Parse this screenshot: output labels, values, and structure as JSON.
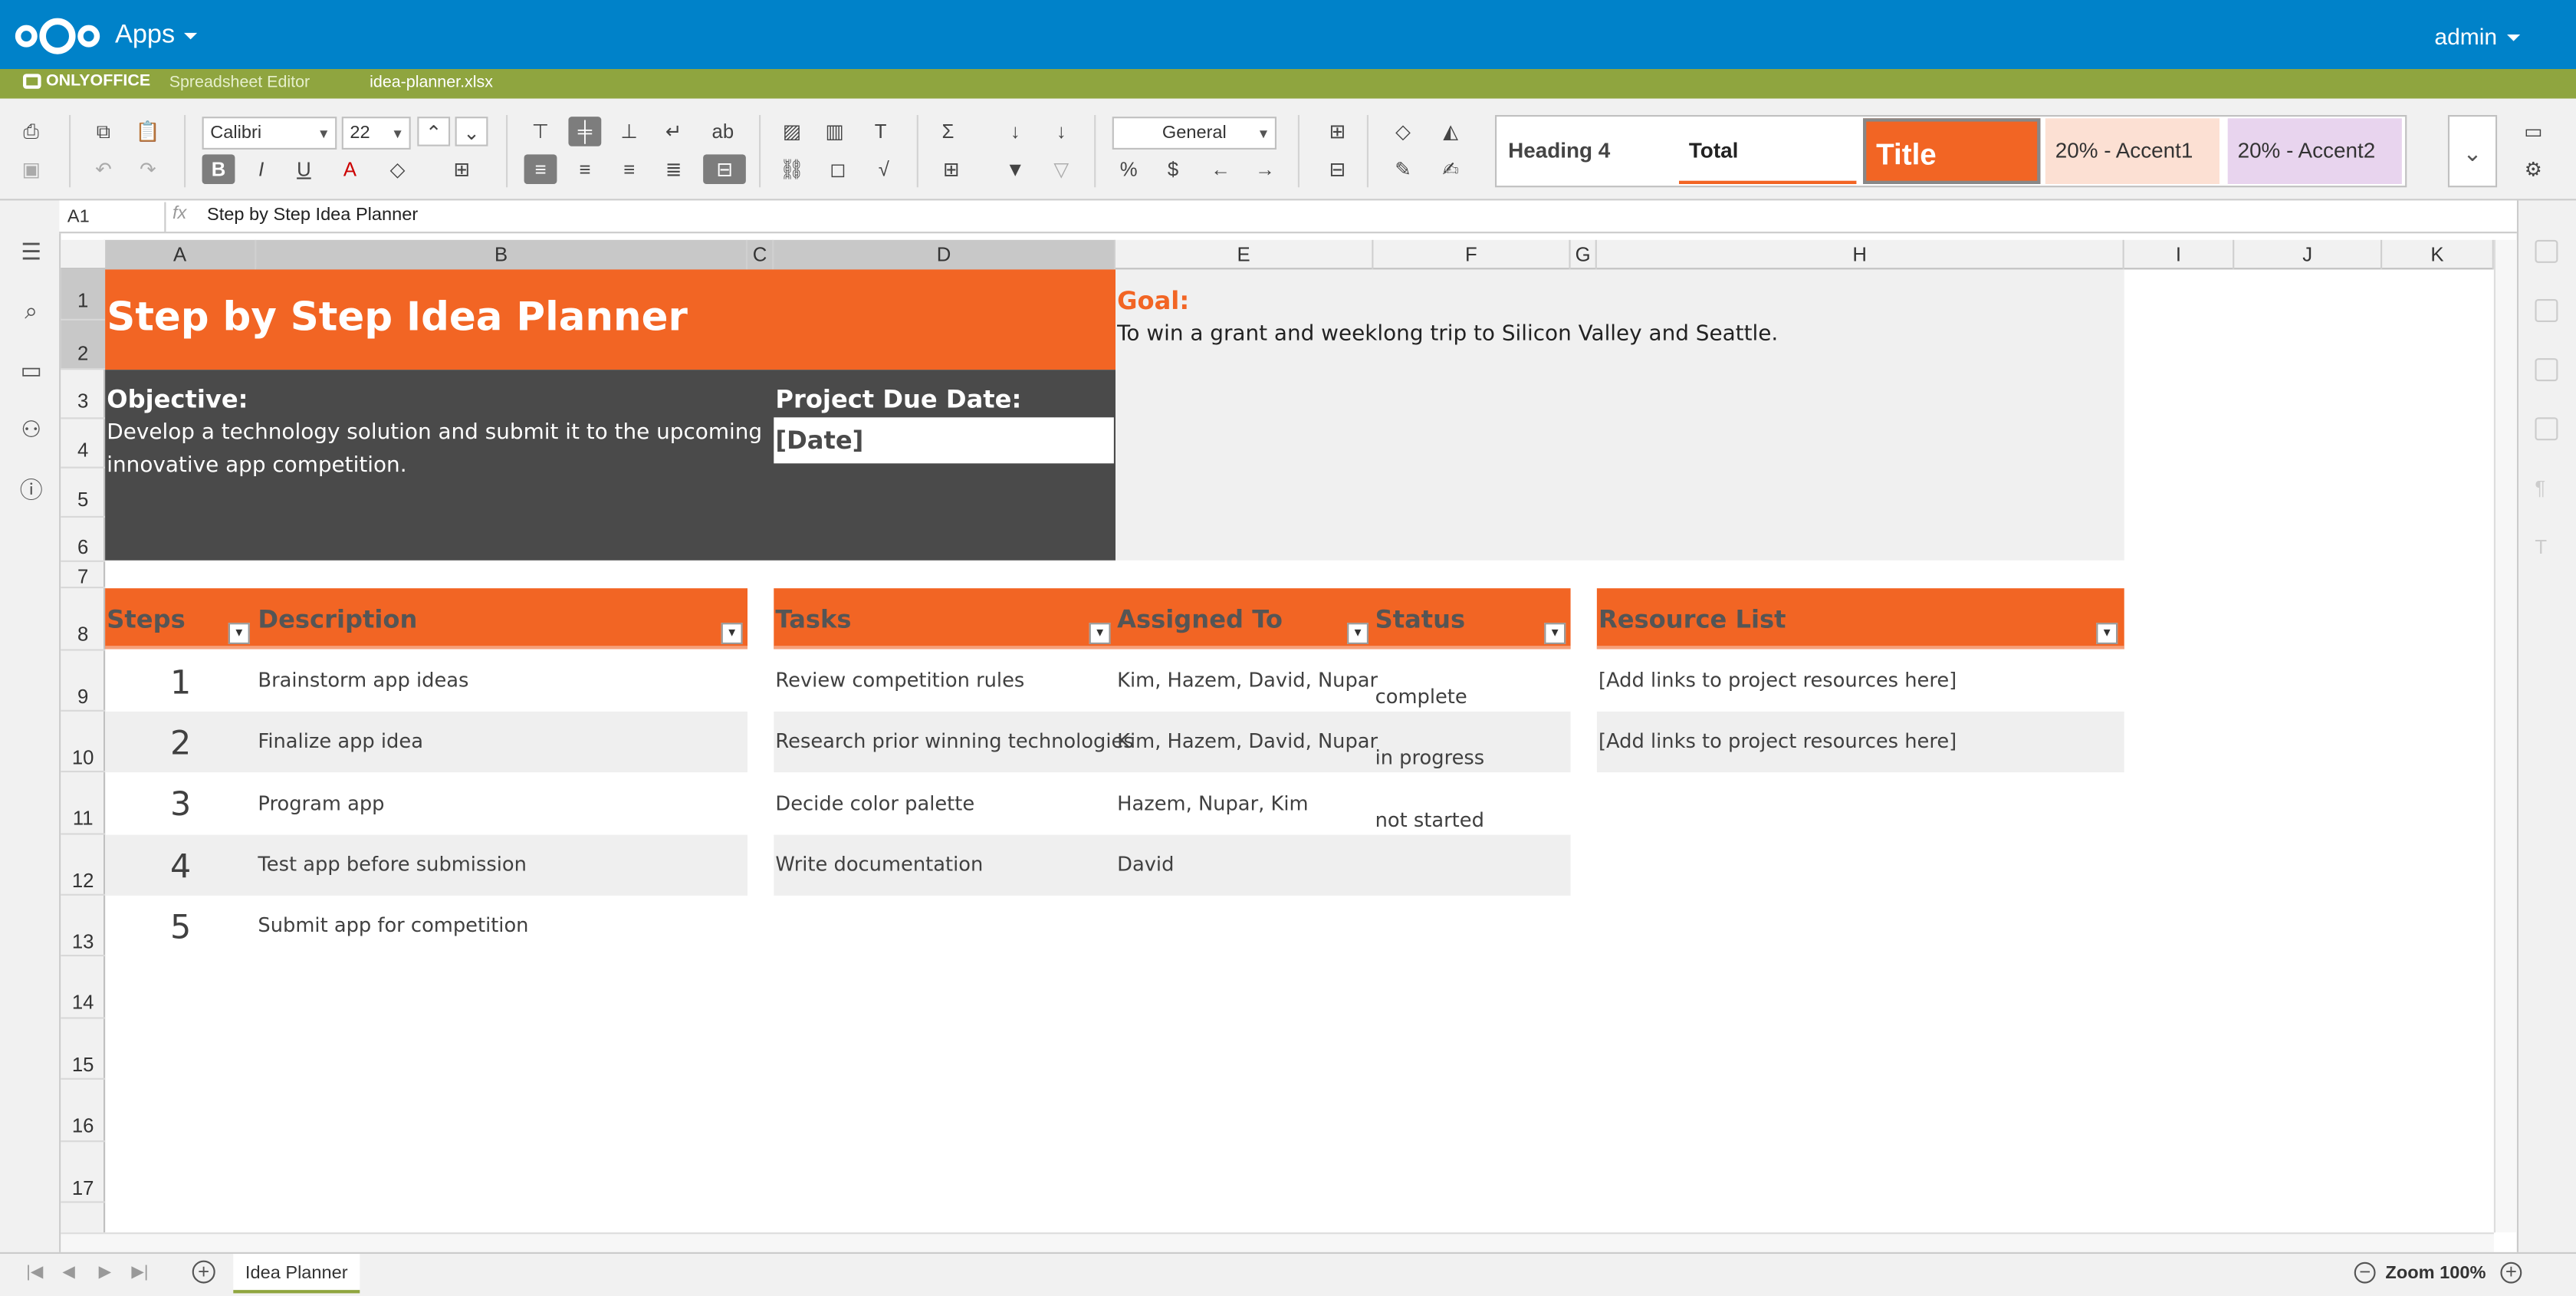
{
  "nav": {
    "apps_label": "Apps",
    "user": "admin"
  },
  "editor": {
    "brand": "ONLYOFFICE",
    "product": "Spreadsheet Editor",
    "file": "idea-planner.xlsx"
  },
  "toolbar": {
    "font_name": "Calibri",
    "font_size": "22",
    "number_format": "General",
    "styles": [
      "Heading 4",
      "Total",
      "Title",
      "20% - Accent1",
      "20% - Accent2"
    ]
  },
  "formula_bar": {
    "cell_ref": "A1",
    "fx": "fx",
    "value": "Step by Step Idea Planner"
  },
  "grid": {
    "columns": [
      "A",
      "B",
      "C",
      "D",
      "E",
      "F",
      "G",
      "H",
      "I",
      "J",
      "K"
    ],
    "rows": [
      "1",
      "2",
      "3",
      "4",
      "5",
      "6",
      "7",
      "8",
      "9",
      "10",
      "11",
      "12",
      "13",
      "14",
      "15",
      "16",
      "17"
    ]
  },
  "sheet": {
    "title": "Step by Step Idea Planner",
    "objective_label": "Objective:",
    "objective_line1": "Develop a technology solution and submit it to the upcoming",
    "objective_line2": "innovative app competition.",
    "due_label": "Project Due Date:",
    "due_value": "[Date]",
    "goal_label": "Goal:",
    "goal_text": "To win a grant and weeklong trip to Silicon Valley and Seattle.",
    "headers": {
      "steps": "Steps",
      "description": "Description",
      "tasks": "Tasks",
      "assigned": "Assigned To",
      "status": "Status",
      "resources": "Resource List"
    },
    "steps": [
      {
        "num": "1",
        "desc": "Brainstorm app ideas"
      },
      {
        "num": "2",
        "desc": "Finalize app idea"
      },
      {
        "num": "3",
        "desc": "Program app"
      },
      {
        "num": "4",
        "desc": "Test app before submission"
      },
      {
        "num": "5",
        "desc": "Submit app for competition"
      }
    ],
    "tasks": [
      {
        "task": "Review competition rules",
        "assigned": "Kim, Hazem, David, Nupar",
        "status": "complete"
      },
      {
        "task": "Research prior winning technologies",
        "assigned": "Kim, Hazem, David, Nupar",
        "status": "in progress"
      },
      {
        "task": "Decide color palette",
        "assigned": "Hazem, Nupar, Kim",
        "status": "not started"
      },
      {
        "task": "Write documentation",
        "assigned": "David",
        "status": ""
      }
    ],
    "resources": [
      "[Add links to project resources here]",
      "[Add links to project resources here]"
    ]
  },
  "bottom": {
    "sheet_tab": "Idea Planner",
    "zoom": "Zoom 100%"
  },
  "colors": {
    "nextcloud_blue": "#0082c9",
    "onlyoffice_green": "#8fa53f",
    "orange": "#f26524",
    "dark_gray": "#4a4a4a"
  }
}
